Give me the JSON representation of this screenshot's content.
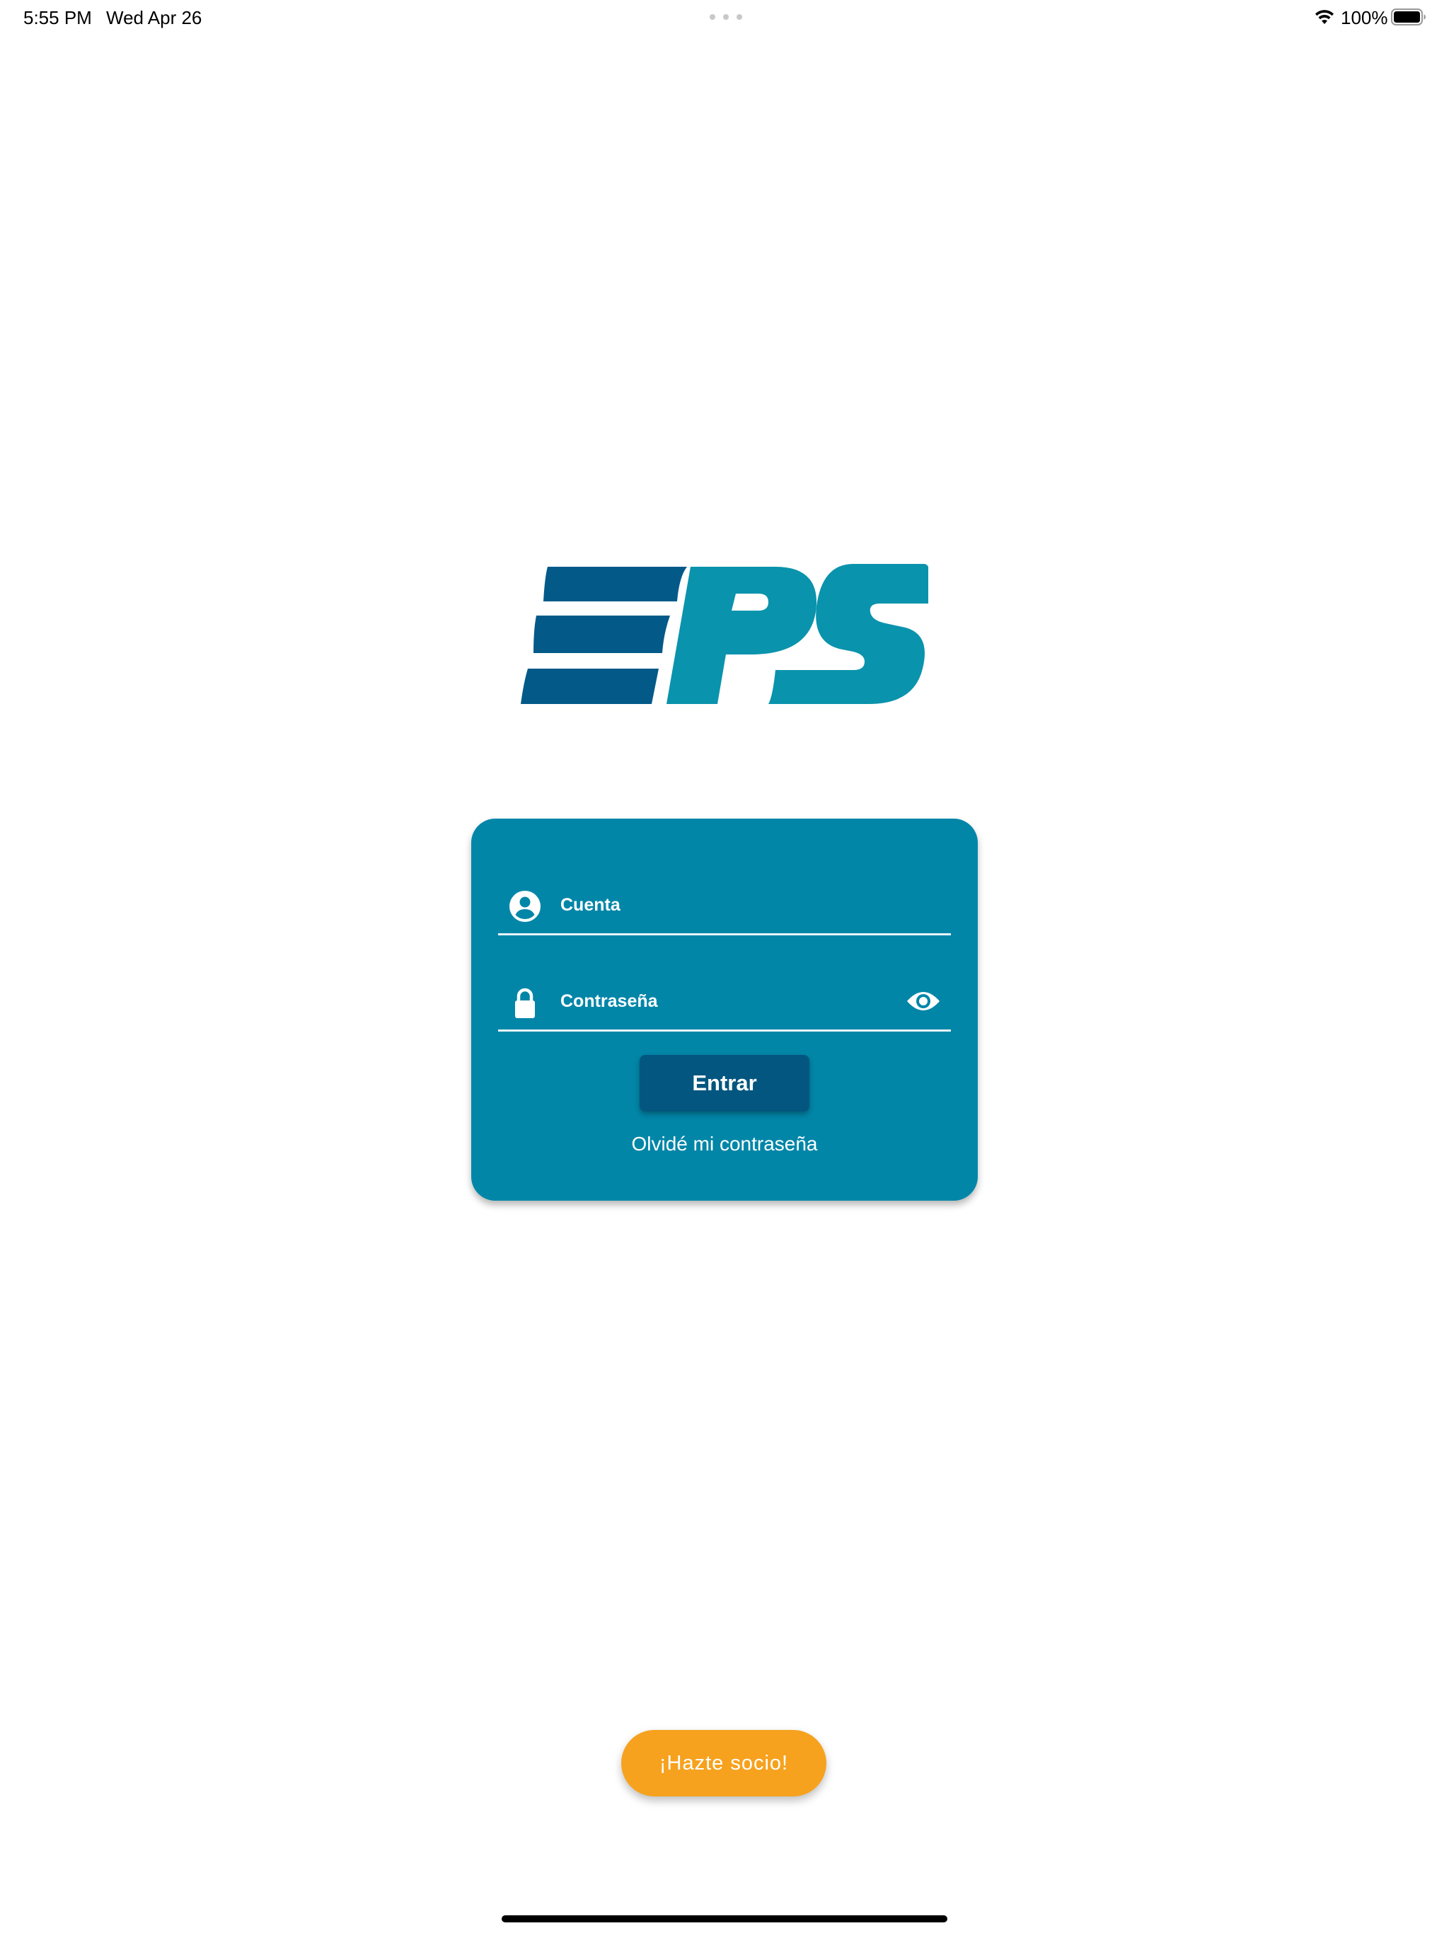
{
  "status_bar": {
    "time": "5:55 PM",
    "date": "Wed Apr 26",
    "battery_percent": "100%",
    "wifi_icon": "wifi-icon",
    "battery_icon": "battery-full-icon"
  },
  "logo": {
    "text": "EPS",
    "colors": {
      "dark": "#035a89",
      "light": "#0a93ac"
    }
  },
  "login": {
    "account": {
      "label": "Cuenta",
      "icon": "account-circle-icon"
    },
    "password": {
      "label": "Contraseña",
      "icon": "lock-icon",
      "toggle_icon": "eye-icon"
    },
    "submit_label": "Entrar",
    "forgot_label": "Olvidé mi contraseña"
  },
  "join": {
    "label": "¡Hazte socio!"
  },
  "colors": {
    "card_background": "#0286a8",
    "button_background": "#035680",
    "join_button": "#f6a21e",
    "text_on_primary": "#ffffff"
  }
}
